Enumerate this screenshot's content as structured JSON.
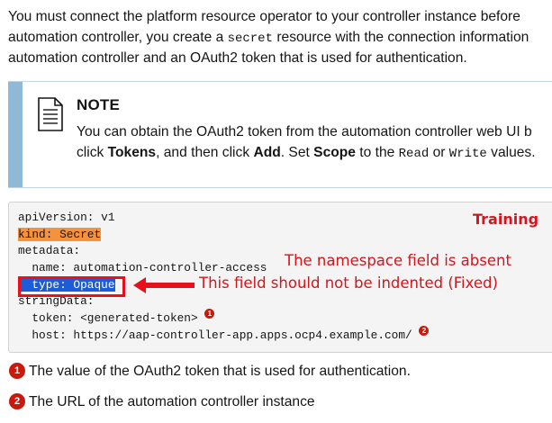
{
  "intro": {
    "line1": "You must connect the platform resource operator to your controller instance before",
    "line2_pre": "automation controller, you create a ",
    "line2_code": "secret",
    "line2_post": " resource with the connection information",
    "line3": "automation controller and an OAuth2 token that is used for authentication."
  },
  "note": {
    "icon": "document-note-icon",
    "title": "NOTE",
    "line1": "You can obtain the OAuth2 token from the automation controller web UI b",
    "line2": {
      "t1": "click ",
      "b1": "Tokens",
      "t2": ", and then click ",
      "b2": "Add",
      "t3": ". Set ",
      "b3": "Scope",
      "t4": " to the ",
      "c1": "Read",
      "t5": " or ",
      "c2": "Write",
      "t6": " values."
    }
  },
  "code": {
    "lines": [
      "apiVersion: v1",
      "kind: Secret",
      "metadata:",
      "  name: automation-controller-access",
      "  type: Opaque",
      "stringData:",
      "  token: <generated-token>",
      "  host: https://aap-controller-app.apps.ocp4.example.com/"
    ],
    "callout1": "1",
    "callout2": "2"
  },
  "annotations": {
    "training": "Training",
    "namespace_absent": "The namespace field is absent",
    "indent_fixed": "This field should not be indented (Fixed)"
  },
  "colors": {
    "annotation_red": "#d6141c",
    "highlight_orange": "#f5923e",
    "highlight_blue": "#1e5bd6",
    "callout_red": "#c9190b",
    "note_bar": "#8fb9d6"
  },
  "callouts": [
    {
      "num": "1",
      "text": "The value of the OAuth2 token that is used for authentication."
    },
    {
      "num": "2",
      "text": "The URL of the automation controller instance"
    }
  ]
}
